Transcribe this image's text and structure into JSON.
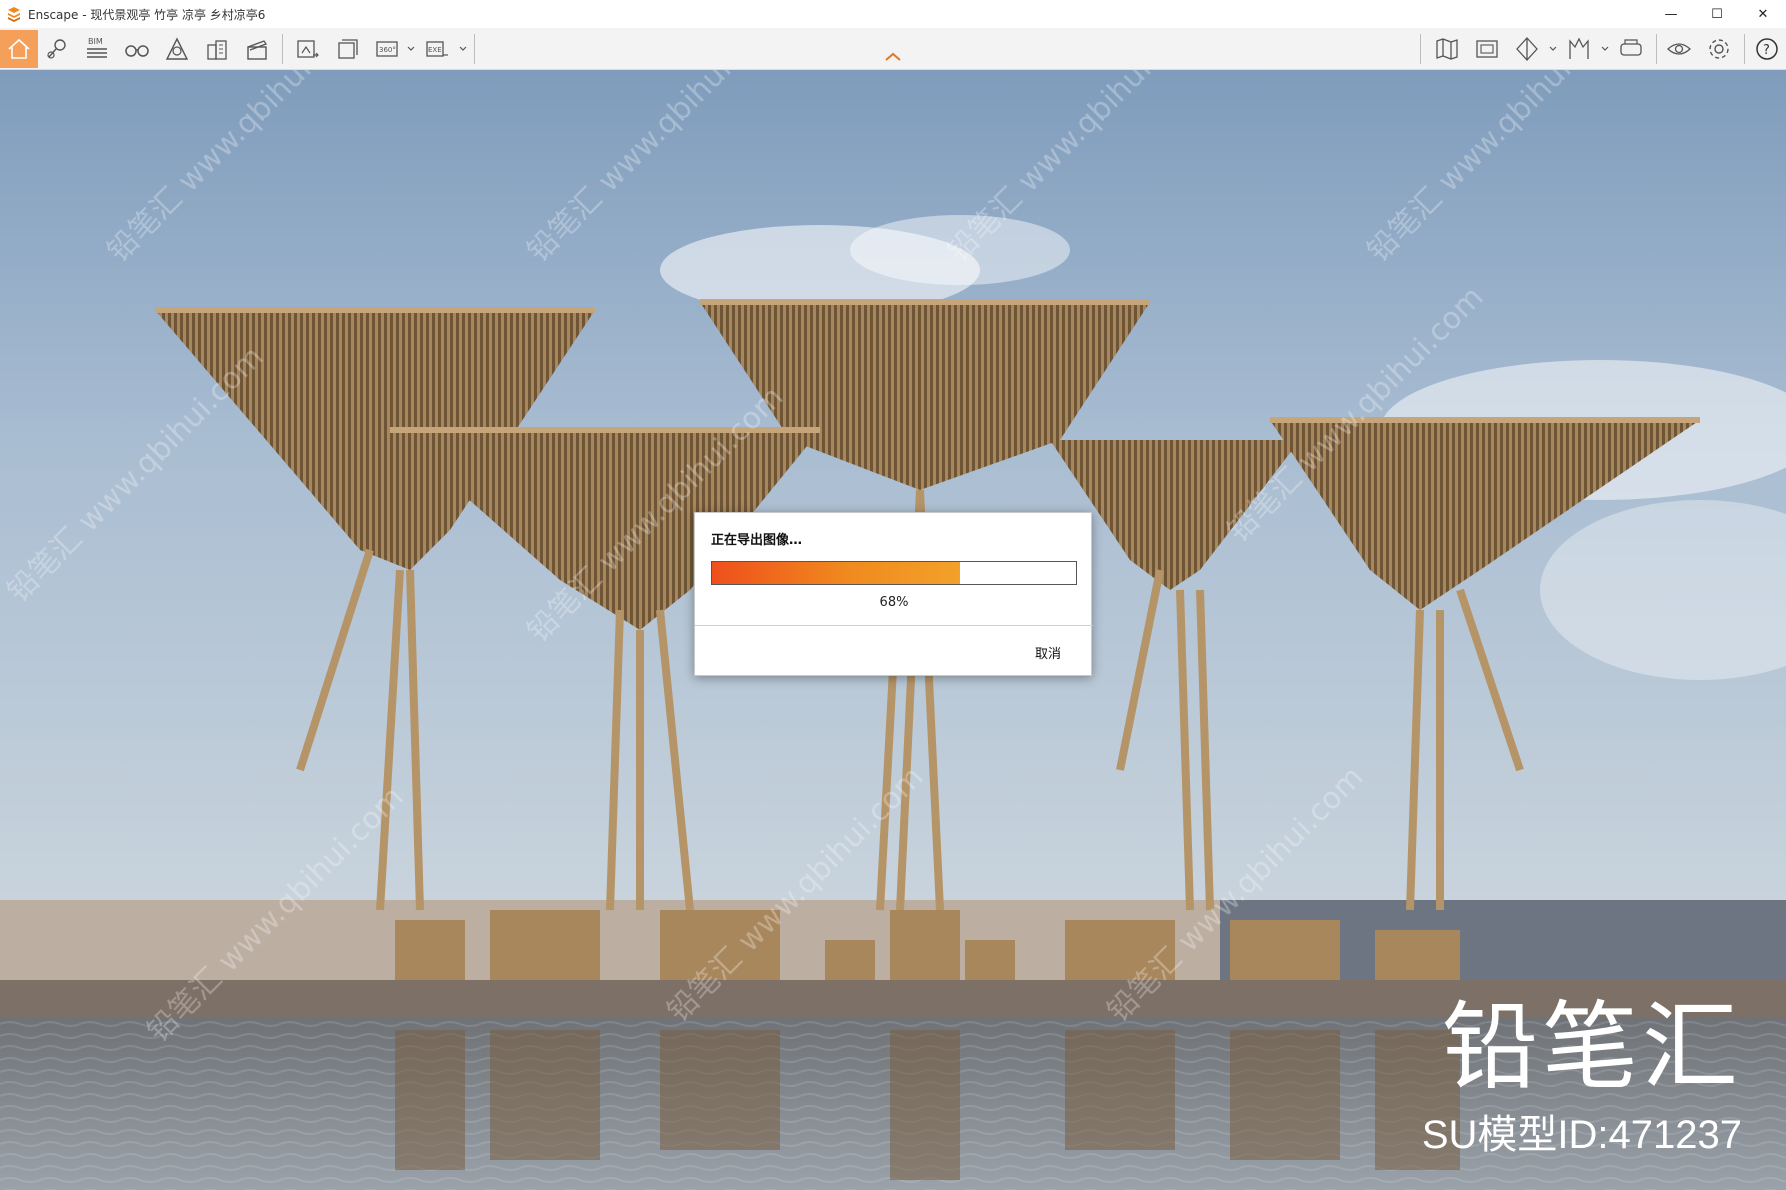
{
  "window": {
    "title": "Enscape - 现代景观亭 竹亭 凉亭 乡村凉亭6",
    "minimize_glyph": "—",
    "maximize_glyph": "☐",
    "close_glyph": "✕"
  },
  "toolbar": {
    "bim_label": "BIM",
    "view_360_label": "360°",
    "exe_label": "EXE",
    "help_label": "?",
    "accent_color": "#f4a05a",
    "left_icons": [
      "home-icon",
      "location-pin-icon",
      "bim-icon",
      "binoculars-icon",
      "asset-library-icon",
      "buildings-icon",
      "clapper-icon",
      "screenshot-icon",
      "batch-render-icon",
      "panorama-360-icon",
      "export-exe-icon"
    ],
    "right_icons": [
      "map-icon",
      "capture-icon",
      "section-icon",
      "bookmark-icon",
      "vr-headset-icon",
      "eye-icon",
      "gear-icon",
      "help-icon"
    ]
  },
  "dialog": {
    "title": "正在导出图像…",
    "progress_percent_value": 68,
    "progress_label": "68%",
    "cancel_label": "取消"
  },
  "watermark": {
    "text": "铅笔汇 www.qbihui.com",
    "brand": "铅笔汇",
    "model_id": "SU模型ID:471237"
  }
}
